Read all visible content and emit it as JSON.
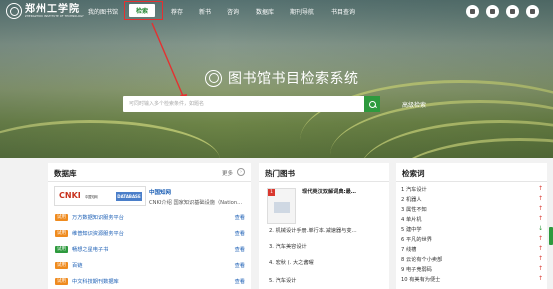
{
  "nav": {
    "logo_name": "郑州工学院",
    "logo_en": "ZHENGZHOU INSTITUTE OF TECHNOLOGY",
    "items": [
      {
        "label": "我的图书馆"
      },
      {
        "label": "检索"
      },
      {
        "label": "荐存"
      },
      {
        "label": "新书"
      },
      {
        "label": "咨询"
      },
      {
        "label": "数据库"
      },
      {
        "label": "期刊导航"
      },
      {
        "label": "书目查询"
      }
    ],
    "icons": [
      "user-icon",
      "grid-icon",
      "menu-icon",
      "more-icon"
    ]
  },
  "hero": {
    "title": "图书馆书目检索系统",
    "search_placeholder": "可同时输入多个检索条件，如题名",
    "advanced": "高级检索"
  },
  "database": {
    "title": "数据库",
    "more": "更多",
    "featured": {
      "name": "中国知网",
      "logo": "CNKI",
      "logo_sub": "中国知网",
      "badge": "DATABASE",
      "desc": "CNKI介绍 国家知识基础设施（Nation…"
    },
    "rows": [
      {
        "badge": "试用",
        "name": "万方数据知识服务平台",
        "link": "查看",
        "color": "orange"
      },
      {
        "badge": "试用",
        "name": "维普知识资源服务平台",
        "link": "查看",
        "color": "orange"
      },
      {
        "badge": "试用",
        "name": "畅想之星电子书",
        "link": "查看",
        "color": "green"
      },
      {
        "badge": "试用",
        "name": "百链",
        "link": "查看",
        "color": "orange"
      },
      {
        "badge": "试用",
        "name": "中文科技期刊数据库",
        "link": "查看",
        "color": "orange"
      }
    ]
  },
  "hot_books": {
    "title": "热门图书",
    "featured_title": "现代英汉双解词典:最…",
    "featured_rank": "1",
    "rows": [
      "2. 机械设计手册.单行本.减速器与变…",
      "3. 汽车美容设计",
      "4. 宏秋 (. 大之酱曜",
      "5. 汽车设计"
    ]
  },
  "keywords": {
    "title": "检索词",
    "rows": [
      {
        "text": "1 汽车设计",
        "trend": "up"
      },
      {
        "text": "2 机器人",
        "trend": "up"
      },
      {
        "text": "3 属性不知",
        "trend": "up"
      },
      {
        "text": "4 单片机",
        "trend": "up"
      },
      {
        "text": "5 建中学",
        "trend": "down"
      },
      {
        "text": "6 平凡的世界",
        "trend": "up"
      },
      {
        "text": "7 线槽",
        "trend": "up"
      },
      {
        "text": "8 云论有个小卖部",
        "trend": "up"
      },
      {
        "text": "9 电子竞弱码",
        "trend": "up"
      },
      {
        "text": "10 有美有为便士",
        "trend": "up"
      }
    ]
  },
  "colors": {
    "accent": "#2e9a3e",
    "link": "#1c5fb5",
    "badge": "#ef8b1f",
    "annotation": "#e53030"
  }
}
